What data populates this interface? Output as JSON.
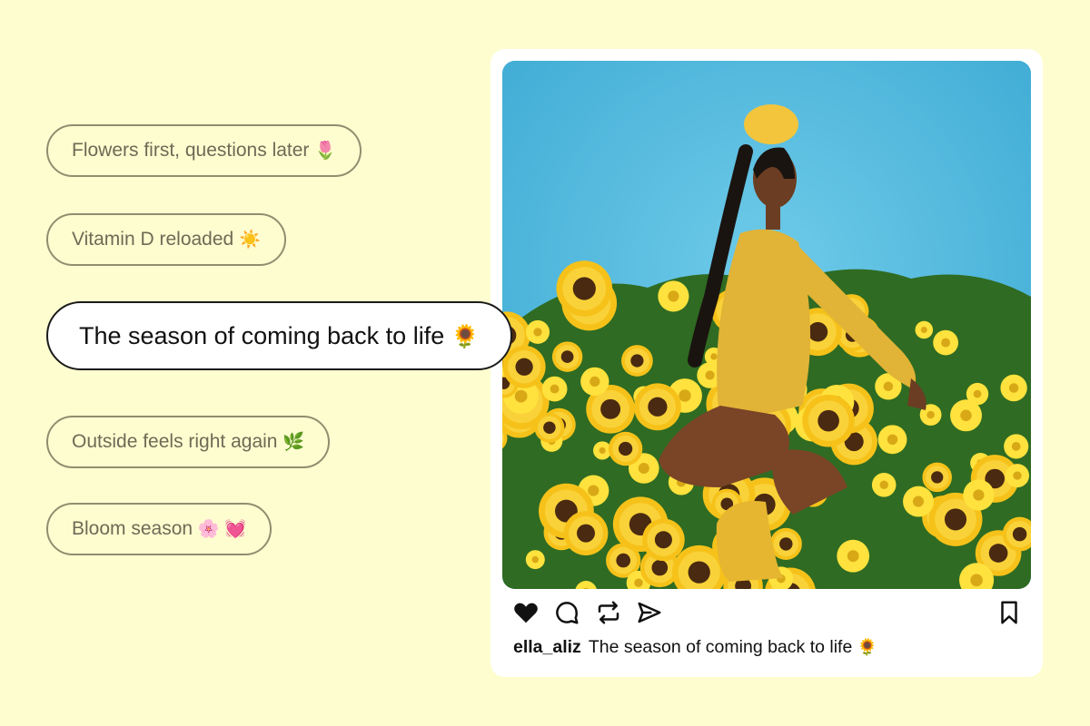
{
  "caption_suggestions": [
    {
      "text": "Flowers first, questions later",
      "emoji": "🌷",
      "selected": false
    },
    {
      "text": "Vitamin D reloaded",
      "emoji": "☀️",
      "selected": false
    },
    {
      "text": "The season of coming back to life",
      "emoji": "🌻",
      "selected": true
    },
    {
      "text": "Outside feels right again",
      "emoji": "🌿",
      "selected": false
    },
    {
      "text": "Bloom season",
      "emoji": "🌸 💓",
      "selected": false
    }
  ],
  "post": {
    "username": "ella_aliz",
    "caption": "The season of coming back to life",
    "caption_emoji": "🌻",
    "liked": true,
    "actions": [
      "heart-icon",
      "comment-icon",
      "repost-icon",
      "share-icon",
      "bookmark-icon"
    ]
  },
  "colors": {
    "background": "#fefdd0",
    "pill_border": "#8f8e6f",
    "pill_text": "#6c6b55",
    "active_border": "#1b1b1b",
    "photo_sky": "#4fb6dc",
    "sunflower": "#f6c21a"
  }
}
